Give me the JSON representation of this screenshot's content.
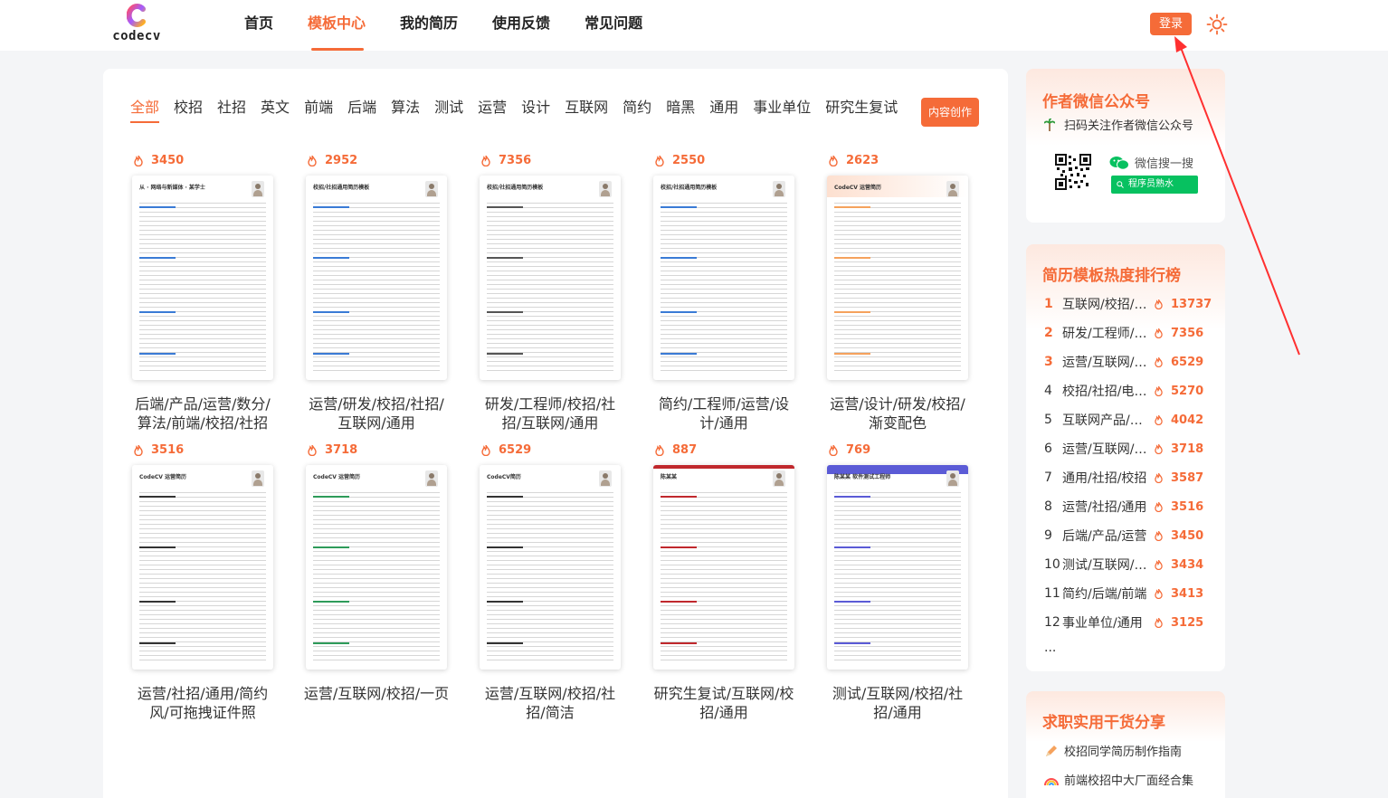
{
  "header": {
    "logo_text": "codecv",
    "nav": [
      "首页",
      "模板中心",
      "我的简历",
      "使用反馈",
      "常见问题"
    ],
    "active_nav": 1,
    "login_label": "登录"
  },
  "filters": {
    "items": [
      "全部",
      "校招",
      "社招",
      "英文",
      "前端",
      "后端",
      "算法",
      "测试",
      "运营",
      "设计",
      "互联网",
      "简约",
      "暗黑",
      "通用",
      "事业单位",
      "研究生复试"
    ],
    "active": 0,
    "create_label": "内容创作"
  },
  "templates": [
    {
      "hot": "3450",
      "title": "后端/产品/运营/数分/算法/前端/校招/社招",
      "head": "从 · 网络与新媒体 · 某学士",
      "accent": "#3a7bd5"
    },
    {
      "hot": "2952",
      "title": "运营/研发/校招/社招/互联网/通用",
      "head": "校招/社招通用简历模板",
      "accent": "#3a7bd5"
    },
    {
      "hot": "7356",
      "title": "研发/工程师/校招/社招/互联网/通用",
      "head": "校招/社招通用简历模板",
      "accent": "#555555"
    },
    {
      "hot": "2550",
      "title": "简约/工程师/运营/设计/通用",
      "head": "校招/社招通用简历模板",
      "accent": "#3a7bd5"
    },
    {
      "hot": "2623",
      "title": "运营/设计/研发/校招/渐变配色",
      "head": "CodeCV 运营简历",
      "accent": "#f5a25d"
    },
    {
      "hot": "3516",
      "title": "运营/社招/通用/简约风/可拖拽证件照",
      "head": "CodeCV 运营简历",
      "accent": "#333333"
    },
    {
      "hot": "3718",
      "title": "运营/互联网/校招/一页",
      "head": "CodeCV 运营简历",
      "accent": "#2e9b5a"
    },
    {
      "hot": "6529",
      "title": "运营/互联网/校招/社招/简洁",
      "head": "CodeCV简历",
      "accent": "#333333"
    },
    {
      "hot": "887",
      "title": "研究生复试/互联网/校招/通用",
      "head": "陈某某",
      "accent": "#c0282d"
    },
    {
      "hot": "769",
      "title": "测试/互联网/校招/社招/通用",
      "head": "陈某某  软件测试工程师",
      "accent": "#5b5bd6"
    }
  ],
  "sidebar": {
    "wechat": {
      "title": "作者微信公众号",
      "subtitle": "扫码关注作者微信公众号",
      "search_label": "微信搜一搜",
      "search_box": "程序员熟水"
    },
    "ranking": {
      "title": "简历模板热度排行榜",
      "items": [
        {
          "no": "1",
          "name": "互联网/校招/前端",
          "count": "13737"
        },
        {
          "no": "2",
          "name": "研发/工程师/校招",
          "count": "7356"
        },
        {
          "no": "3",
          "name": "运营/互联网/校招",
          "count": "6529"
        },
        {
          "no": "4",
          "name": "校招/社招/电商运营",
          "count": "5270"
        },
        {
          "no": "5",
          "name": "互联网产品/运营",
          "count": "4042"
        },
        {
          "no": "6",
          "name": "运营/互联网/校招",
          "count": "3718"
        },
        {
          "no": "7",
          "name": "通用/社招/校招",
          "count": "3587"
        },
        {
          "no": "8",
          "name": "运营/社招/通用",
          "count": "3516"
        },
        {
          "no": "9",
          "name": "后端/产品/运营",
          "count": "3450"
        },
        {
          "no": "10",
          "name": "测试/互联网/校招",
          "count": "3434"
        },
        {
          "no": "11",
          "name": "简约/后端/前端",
          "count": "3413"
        },
        {
          "no": "12",
          "name": "事业单位/通用",
          "count": "3125"
        }
      ],
      "more": "..."
    },
    "share": {
      "title": "求职实用干货分享",
      "items": [
        "校招同学简历制作指南",
        "前端校招中大厂面经合集"
      ]
    }
  },
  "colors": {
    "accent": "#f56b38",
    "wechat_green": "#07c160"
  }
}
